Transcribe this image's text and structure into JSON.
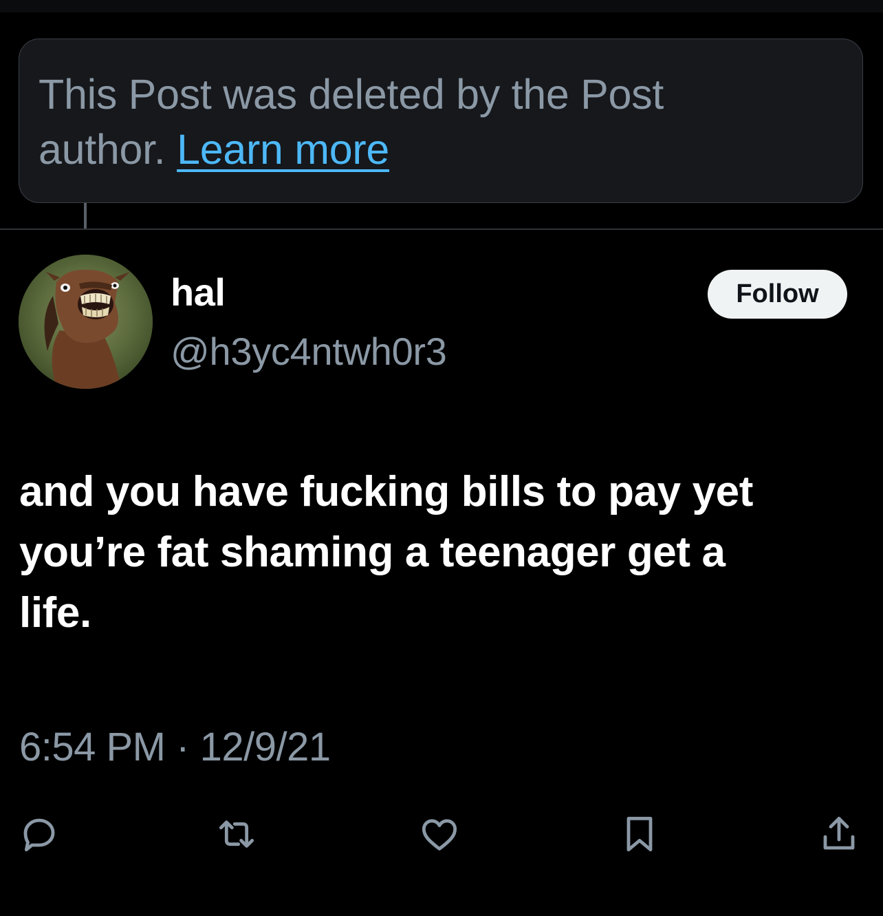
{
  "deleted_notice": {
    "text": "This Post was deleted by the Post",
    "text_line2": "author.",
    "link_label": "Learn more"
  },
  "author": {
    "display_name": "hal",
    "handle": "@h3yc4ntwh0r3",
    "avatar_icon": "horse-avatar"
  },
  "follow_button": {
    "label": "Follow"
  },
  "post": {
    "text_lines": [
      "and you have fucking bills to pay yet",
      "you’re fat shaming a teenager get a",
      "life."
    ],
    "time": "6:54 PM",
    "separator": "·",
    "date": "12/9/21"
  },
  "actions": [
    {
      "icon": "reply-icon"
    },
    {
      "icon": "repost-icon"
    },
    {
      "icon": "like-icon"
    },
    {
      "icon": "bookmark-icon"
    },
    {
      "icon": "share-icon"
    }
  ],
  "colors": {
    "background": "#000000",
    "muted_text": "#8b98a5",
    "link": "#4db8f7",
    "follow_bg": "#eff3f4"
  }
}
